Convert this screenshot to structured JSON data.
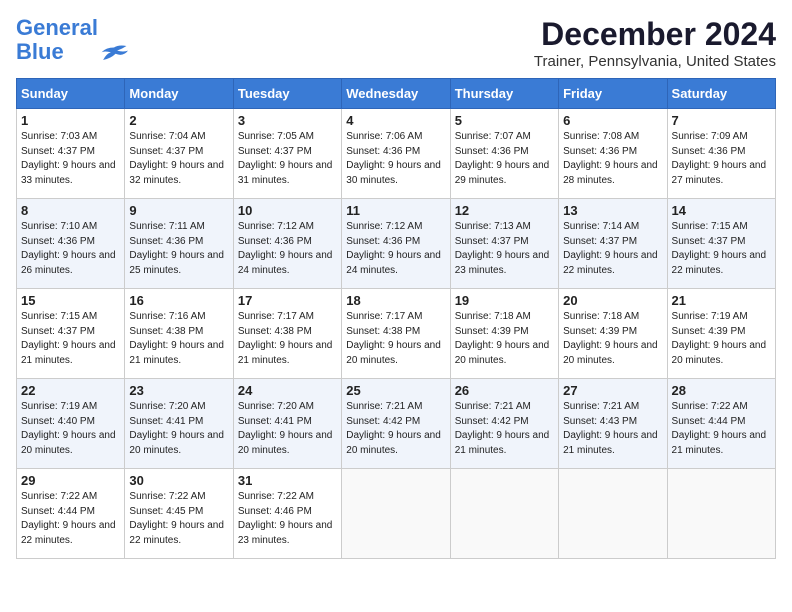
{
  "logo": {
    "line1": "General",
    "line2": "Blue"
  },
  "title": "December 2024",
  "subtitle": "Trainer, Pennsylvania, United States",
  "days_of_week": [
    "Sunday",
    "Monday",
    "Tuesday",
    "Wednesday",
    "Thursday",
    "Friday",
    "Saturday"
  ],
  "weeks": [
    [
      {
        "day": 1,
        "rise": "7:03 AM",
        "set": "4:37 PM",
        "daylight": "9 hours and 33 minutes."
      },
      {
        "day": 2,
        "rise": "7:04 AM",
        "set": "4:37 PM",
        "daylight": "9 hours and 32 minutes."
      },
      {
        "day": 3,
        "rise": "7:05 AM",
        "set": "4:37 PM",
        "daylight": "9 hours and 31 minutes."
      },
      {
        "day": 4,
        "rise": "7:06 AM",
        "set": "4:36 PM",
        "daylight": "9 hours and 30 minutes."
      },
      {
        "day": 5,
        "rise": "7:07 AM",
        "set": "4:36 PM",
        "daylight": "9 hours and 29 minutes."
      },
      {
        "day": 6,
        "rise": "7:08 AM",
        "set": "4:36 PM",
        "daylight": "9 hours and 28 minutes."
      },
      {
        "day": 7,
        "rise": "7:09 AM",
        "set": "4:36 PM",
        "daylight": "9 hours and 27 minutes."
      }
    ],
    [
      {
        "day": 8,
        "rise": "7:10 AM",
        "set": "4:36 PM",
        "daylight": "9 hours and 26 minutes."
      },
      {
        "day": 9,
        "rise": "7:11 AM",
        "set": "4:36 PM",
        "daylight": "9 hours and 25 minutes."
      },
      {
        "day": 10,
        "rise": "7:12 AM",
        "set": "4:36 PM",
        "daylight": "9 hours and 24 minutes."
      },
      {
        "day": 11,
        "rise": "7:12 AM",
        "set": "4:36 PM",
        "daylight": "9 hours and 24 minutes."
      },
      {
        "day": 12,
        "rise": "7:13 AM",
        "set": "4:37 PM",
        "daylight": "9 hours and 23 minutes."
      },
      {
        "day": 13,
        "rise": "7:14 AM",
        "set": "4:37 PM",
        "daylight": "9 hours and 22 minutes."
      },
      {
        "day": 14,
        "rise": "7:15 AM",
        "set": "4:37 PM",
        "daylight": "9 hours and 22 minutes."
      }
    ],
    [
      {
        "day": 15,
        "rise": "7:15 AM",
        "set": "4:37 PM",
        "daylight": "9 hours and 21 minutes."
      },
      {
        "day": 16,
        "rise": "7:16 AM",
        "set": "4:38 PM",
        "daylight": "9 hours and 21 minutes."
      },
      {
        "day": 17,
        "rise": "7:17 AM",
        "set": "4:38 PM",
        "daylight": "9 hours and 21 minutes."
      },
      {
        "day": 18,
        "rise": "7:17 AM",
        "set": "4:38 PM",
        "daylight": "9 hours and 20 minutes."
      },
      {
        "day": 19,
        "rise": "7:18 AM",
        "set": "4:39 PM",
        "daylight": "9 hours and 20 minutes."
      },
      {
        "day": 20,
        "rise": "7:18 AM",
        "set": "4:39 PM",
        "daylight": "9 hours and 20 minutes."
      },
      {
        "day": 21,
        "rise": "7:19 AM",
        "set": "4:39 PM",
        "daylight": "9 hours and 20 minutes."
      }
    ],
    [
      {
        "day": 22,
        "rise": "7:19 AM",
        "set": "4:40 PM",
        "daylight": "9 hours and 20 minutes."
      },
      {
        "day": 23,
        "rise": "7:20 AM",
        "set": "4:41 PM",
        "daylight": "9 hours and 20 minutes."
      },
      {
        "day": 24,
        "rise": "7:20 AM",
        "set": "4:41 PM",
        "daylight": "9 hours and 20 minutes."
      },
      {
        "day": 25,
        "rise": "7:21 AM",
        "set": "4:42 PM",
        "daylight": "9 hours and 20 minutes."
      },
      {
        "day": 26,
        "rise": "7:21 AM",
        "set": "4:42 PM",
        "daylight": "9 hours and 21 minutes."
      },
      {
        "day": 27,
        "rise": "7:21 AM",
        "set": "4:43 PM",
        "daylight": "9 hours and 21 minutes."
      },
      {
        "day": 28,
        "rise": "7:22 AM",
        "set": "4:44 PM",
        "daylight": "9 hours and 21 minutes."
      }
    ],
    [
      {
        "day": 29,
        "rise": "7:22 AM",
        "set": "4:44 PM",
        "daylight": "9 hours and 22 minutes."
      },
      {
        "day": 30,
        "rise": "7:22 AM",
        "set": "4:45 PM",
        "daylight": "9 hours and 22 minutes."
      },
      {
        "day": 31,
        "rise": "7:22 AM",
        "set": "4:46 PM",
        "daylight": "9 hours and 23 minutes."
      },
      null,
      null,
      null,
      null
    ]
  ],
  "labels": {
    "sunrise": "Sunrise:",
    "sunset": "Sunset:",
    "daylight": "Daylight:"
  }
}
